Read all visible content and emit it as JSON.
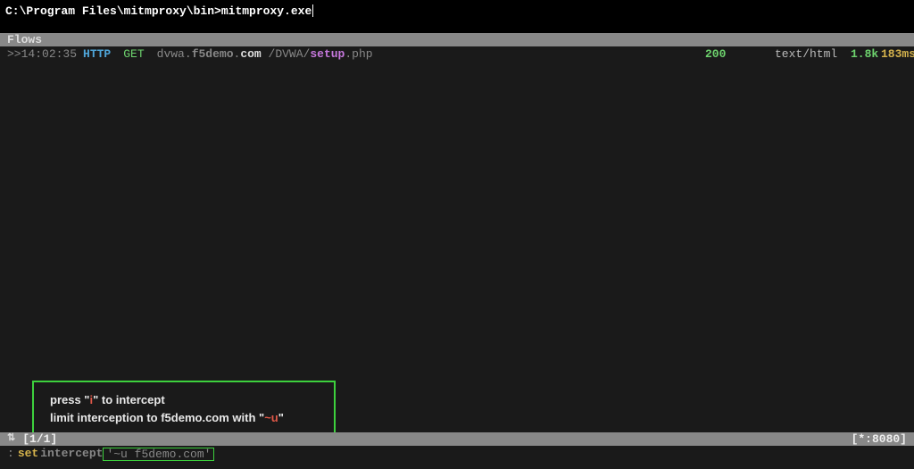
{
  "title": "C:\\Program Files\\mitmproxy\\bin>mitmproxy.exe",
  "flows_header": "Flows",
  "flow": {
    "cursor": ">>",
    "time": "14:02:35",
    "http": "HTTP",
    "method": "GET",
    "host_sub": "dvwa",
    "host_mid": "f5demo",
    "host_tld": "com",
    "path_prefix": "/DVWA/",
    "path_file": "setup",
    "path_ext": ".php",
    "status": "200",
    "content_type": "text/html",
    "size": "1.8k",
    "duration": "183ms"
  },
  "overlay": {
    "line1_prefix": "press \"",
    "line1_key": "i",
    "line1_suffix": "\" to intercept",
    "line2_prefix": "limit interception to f5demo.com with \"",
    "line2_key": "~u",
    "line2_suffix": "\""
  },
  "status_bar": {
    "icon": "⇅",
    "count": "[1/1]",
    "listen": "[*:8080]"
  },
  "command": {
    "colon": ":",
    "set": "set",
    "intercept": "intercept",
    "arg": "'~u f5demo.com'"
  }
}
